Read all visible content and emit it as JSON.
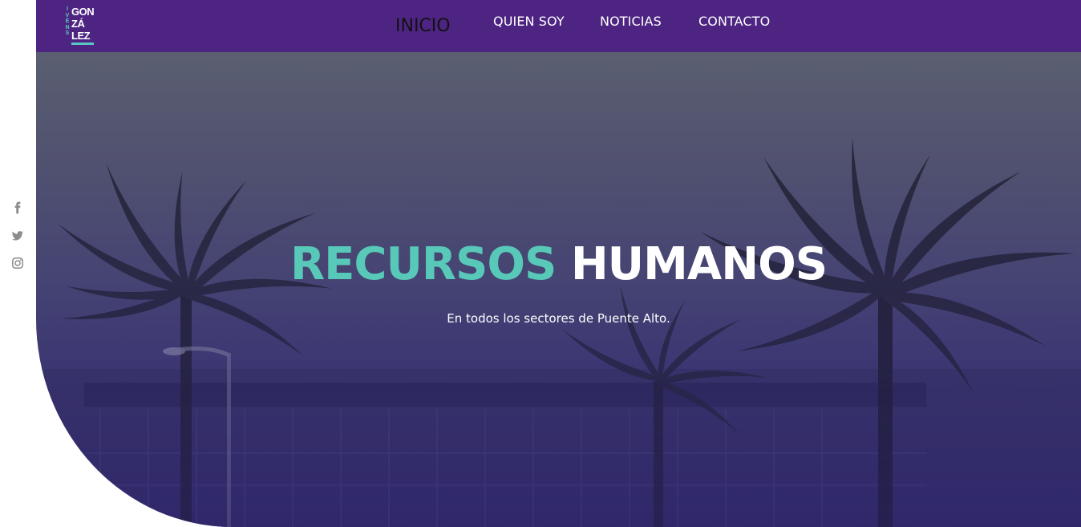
{
  "brand": {
    "logo_side": [
      "I",
      "V",
      "E",
      "N",
      "S"
    ],
    "logo_lines": [
      "GON",
      "ZÁ",
      "LEZ"
    ],
    "accent": "#58c8b8",
    "nav_bg": "#4e2482"
  },
  "nav": {
    "items": [
      {
        "label": "INICIO",
        "active": true
      },
      {
        "label": "QUIEN SOY",
        "active": false
      },
      {
        "label": "NOTICIAS",
        "active": false
      },
      {
        "label": "CONTACTO",
        "active": false
      }
    ]
  },
  "social": {
    "icons": [
      "facebook-icon",
      "twitter-icon",
      "instagram-icon"
    ]
  },
  "hero": {
    "title_accent": "RECURSOS",
    "title_rest": "HUMANOS",
    "subtitle": "En todos los sectores de Puente Alto."
  }
}
